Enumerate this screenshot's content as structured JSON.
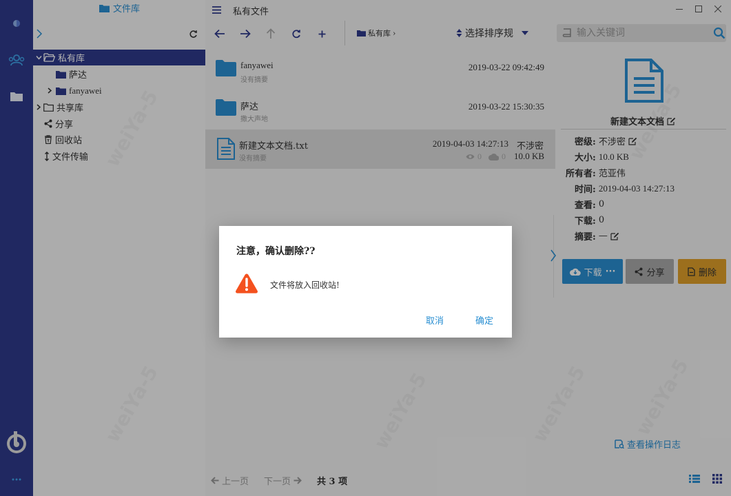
{
  "app": {
    "window_title": "私有文件"
  },
  "rail": {
    "icons": [
      "leaf-icon",
      "users-icon",
      "folder-icon",
      "logo-icon",
      "more-icon"
    ]
  },
  "tree": {
    "title": "文件库",
    "items": [
      {
        "label": "私有库"
      },
      {
        "label": "萨达"
      },
      {
        "label": "fanyawei"
      },
      {
        "label": "共享库"
      },
      {
        "label": "分享"
      },
      {
        "label": "回收站"
      },
      {
        "label": "文件传输"
      }
    ]
  },
  "toolbar": {
    "breadcrumb": "私有库",
    "sort_label": "选择排序规",
    "search_placeholder": "输入关键词"
  },
  "files": [
    {
      "name": "fanyawei",
      "desc": "没有摘要",
      "time": "2019-03-22 09:42:49"
    },
    {
      "name": "萨达",
      "desc": "撒大声地",
      "time": "2019-03-22 15:30:35"
    },
    {
      "name": "新建文本文档.txt",
      "desc": "没有摘要",
      "time": "2019-04-03 14:27:13",
      "secrecy": "不涉密",
      "views": "0",
      "downloads": "0",
      "size": "10.0 KB"
    }
  ],
  "pager": {
    "prev": "上一页",
    "next": "下一页",
    "total": "共 3 项"
  },
  "detail": {
    "name": "新建文本文档",
    "secrecy_k": "密级:",
    "secrecy_v": "不涉密",
    "size_k": "大小:",
    "size_v": "10.0 KB",
    "owner_k": "所有者:",
    "owner_v": "范亚伟",
    "time_k": "时间:",
    "time_v": "2019-04-03 14:27:13",
    "views_k": "查看:",
    "views_v": "0",
    "downloads_k": "下载:",
    "downloads_v": "0",
    "summary_k": "摘要:",
    "summary_v": "—",
    "download_btn": "下载",
    "share_btn": "分享",
    "delete_btn": "删除",
    "log_link": "查看操作日志"
  },
  "dialog": {
    "title": "注意，确认删除??",
    "message": "文件将放入回收站!",
    "cancel": "取消",
    "confirm": "确定"
  },
  "watermark": "weiYa-5",
  "colors": {
    "rail": "#2f3a8c",
    "accent": "#2a8fd2",
    "download": "#2a8fd2",
    "share": "#a9a9a9",
    "delete": "#e0a02a",
    "warning": "#f4511e"
  }
}
